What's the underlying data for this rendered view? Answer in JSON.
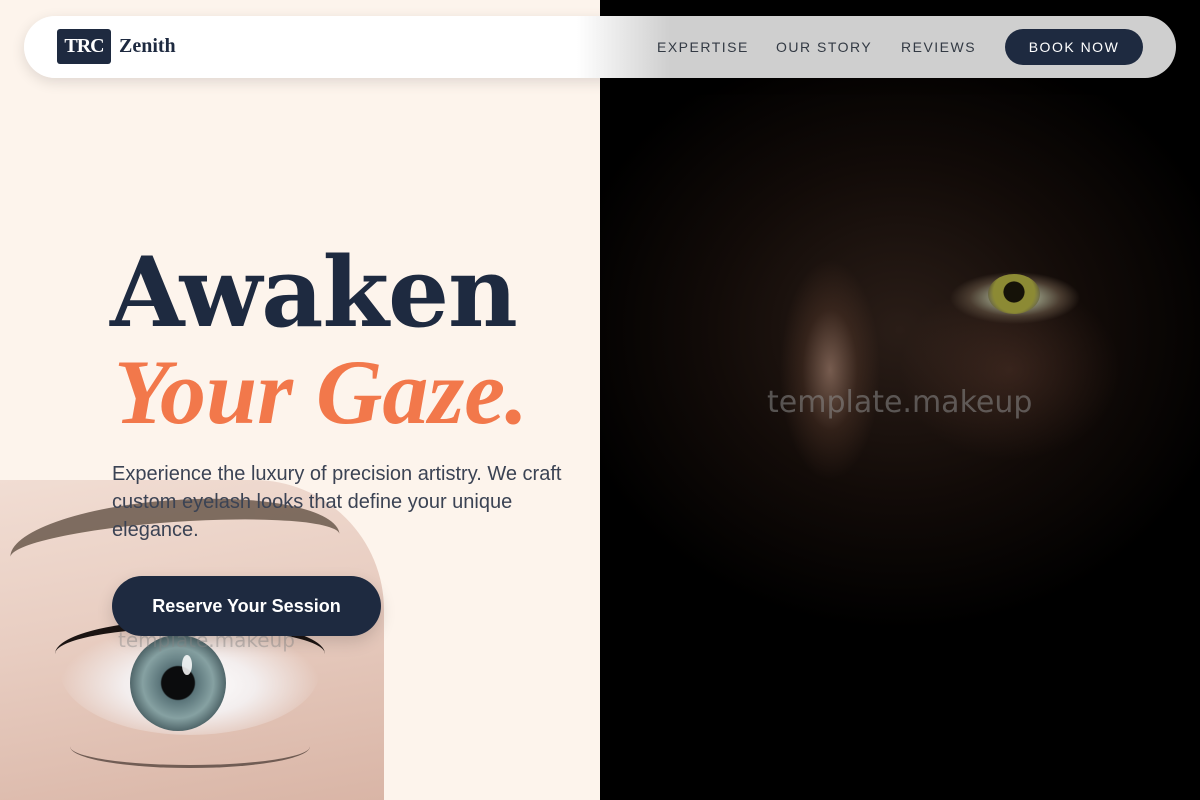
{
  "header": {
    "logo_mark": "TRC",
    "logo_text": "Zenith",
    "nav": [
      "EXPERTISE",
      "OUR STORY",
      "REVIEWS"
    ],
    "cta_label": "BOOK NOW"
  },
  "hero": {
    "title_line1": "Awaken",
    "title_line2": "Your Gaze.",
    "description": "Experience the luxury of precision artistry. We craft custom eyelash looks that define your unique elegance.",
    "cta_label": "Reserve Your Session"
  },
  "images": {
    "right_watermark": "template.makeup",
    "left_watermark": "template.makeup"
  },
  "colors": {
    "navy": "#1E2A40",
    "accent": "#F2784B",
    "cream": "#FDF4EC"
  }
}
